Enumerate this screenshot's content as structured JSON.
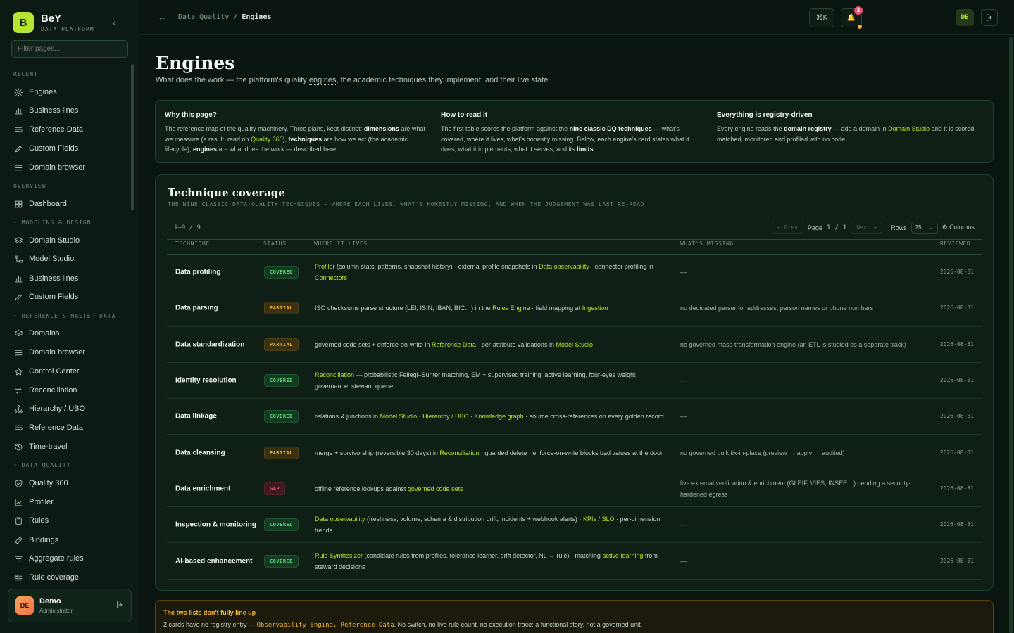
{
  "brand": {
    "logo": "B",
    "name": "BeY",
    "sub": "DATA PLATFORM"
  },
  "sidebar": {
    "filter_placeholder": "Filter pages...",
    "sections": {
      "recent": "RECENT",
      "overview": "OVERVIEW",
      "modeling": "◦ MODELING & DESIGN",
      "reference": "◦ REFERENCE & MASTER DATA",
      "quality": "◦ DATA QUALITY"
    },
    "items": [
      {
        "label": "Engines",
        "icon": "engine-icon"
      },
      {
        "label": "Business lines",
        "icon": "bar-chart-icon"
      },
      {
        "label": "Reference Data",
        "icon": "list-icon"
      },
      {
        "label": "Custom Fields",
        "icon": "pencil-icon"
      },
      {
        "label": "Domain browser",
        "icon": "menu-icon"
      },
      {
        "label": "Dashboard",
        "icon": "grid-icon"
      },
      {
        "label": "Domain Studio",
        "icon": "layers-icon"
      },
      {
        "label": "Model Studio",
        "icon": "model-icon"
      },
      {
        "label": "Business lines",
        "icon": "bar-chart-icon"
      },
      {
        "label": "Custom Fields",
        "icon": "pencil-icon"
      },
      {
        "label": "Domains",
        "icon": "layers-icon"
      },
      {
        "label": "Domain browser",
        "icon": "menu-icon"
      },
      {
        "label": "Control Center",
        "icon": "star-icon"
      },
      {
        "label": "Reconciliation",
        "icon": "swap-icon"
      },
      {
        "label": "Hierarchy / UBO",
        "icon": "hierarchy-icon"
      },
      {
        "label": "Reference Data",
        "icon": "list-icon"
      },
      {
        "label": "Time-travel",
        "icon": "history-icon"
      },
      {
        "label": "Quality 360",
        "icon": "shield-check-icon"
      },
      {
        "label": "Profiler",
        "icon": "line-chart-icon"
      },
      {
        "label": "Rules",
        "icon": "clipboard-icon"
      },
      {
        "label": "Bindings",
        "icon": "link-icon"
      },
      {
        "label": "Aggregate rules",
        "icon": "filter-icon"
      },
      {
        "label": "Rule coverage",
        "icon": "coverage-icon"
      }
    ]
  },
  "user": {
    "initials": "DE",
    "name": "Demo",
    "role": "Administrator"
  },
  "header": {
    "crumb_parent": "Data Quality",
    "crumb_sep": "/",
    "crumb_current": "Engines",
    "shortcut": "⌘K",
    "notif_count": "2",
    "avatar": "DE"
  },
  "page": {
    "title": "Engines",
    "subtitle_pre": "What does the work — the platform's quality ",
    "subtitle_u": "engines",
    "subtitle_post": ", the academic techniques they implement, and their live state"
  },
  "info": {
    "c1_h": "Why this page?",
    "c1_t1": "The reference map of the quality machinery. Three plans, kept distinct: ",
    "c1_b1": "dimensions",
    "c1_t2": " are what we measure (a result, read on ",
    "c1_l1": "Quality 360",
    "c1_t3": "), ",
    "c1_b2": "techniques",
    "c1_t4": " are how we act (the academic lifecycle), ",
    "c1_b3": "engines",
    "c1_t5": " are what does the work — described here.",
    "c2_h": "How to read it",
    "c2_t1": "The first table scores the platform against the ",
    "c2_b1": "nine classic DQ techniques",
    "c2_t2": " — what's covered, where it lives, what's honestly missing. Below, each engine's card states what it does, what it implements, what it serves, and its ",
    "c2_b2": "limits",
    "c2_t3": ".",
    "c3_h": "Everything is registry-driven",
    "c3_t1": "Every engine reads the ",
    "c3_b1": "domain registry",
    "c3_t2": " — add a domain in ",
    "c3_l1": "Domain Studio",
    "c3_t3": " and it is scored, matched, monitored and profiled with no code."
  },
  "coverage": {
    "title": "Technique coverage",
    "subtitle": "THE NINE CLASSIC DATA-QUALITY TECHNIQUES — WHERE EACH LIVES, WHAT'S HONESTLY MISSING, AND WHEN THE JUDGEMENT WAS LAST RE-READ",
    "count": "1–9 / 9",
    "prev": "← Prev",
    "page_label": "Page",
    "page_num": "1",
    "page_of": "/",
    "page_total": "1",
    "next": "Next →",
    "rows_label": "Rows",
    "rows_value": "25",
    "columns_btn": "⚙ Columns",
    "headers": {
      "technique": "TECHNIQUE",
      "status": "STATUS",
      "where": "WHERE IT LIVES",
      "missing": "WHAT'S MISSING",
      "reviewed": "REVIEWED"
    },
    "rows": [
      {
        "technique": "Data profiling",
        "status": "COVERED",
        "kind": "covered",
        "where": [
          [
            "l",
            "Profiler"
          ],
          [
            "t",
            " (column stats, patterns, snapshot history) · external profile snapshots in "
          ],
          [
            "l",
            "Data observability"
          ],
          [
            "t",
            " · connector profiling in "
          ],
          [
            "l",
            "Connectors"
          ]
        ],
        "missing": "—",
        "reviewed": "2026-08-31"
      },
      {
        "technique": "Data parsing",
        "status": "PARTIAL",
        "kind": "partial",
        "where": [
          [
            "t",
            "ISO checksums parse structure (LEI, ISIN, IBAN, BIC…) in the "
          ],
          [
            "l",
            "Rules Engine"
          ],
          [
            "t",
            " · field mapping at "
          ],
          [
            "l",
            "Ingestion"
          ]
        ],
        "missing": "no dedicated parser for addresses, person names or phone numbers",
        "reviewed": "2026-08-31"
      },
      {
        "technique": "Data standardization",
        "status": "PARTIAL",
        "kind": "partial",
        "where": [
          [
            "t",
            "governed code sets + enforce-on-write in "
          ],
          [
            "l",
            "Reference Data"
          ],
          [
            "t",
            " · per-attribute validations in "
          ],
          [
            "l",
            "Model Studio"
          ]
        ],
        "missing": "no governed mass-transformation engine (an ETL is studied as a separate track)",
        "reviewed": "2026-08-31"
      },
      {
        "technique": "Identity resolution",
        "status": "COVERED",
        "kind": "covered",
        "where": [
          [
            "l",
            "Reconciliation"
          ],
          [
            "t",
            " — probabilistic Fellegi–Sunter matching, EM + supervised training, active learning, four-eyes weight governance, steward queue"
          ]
        ],
        "missing": "—",
        "reviewed": "2026-08-31"
      },
      {
        "technique": "Data linkage",
        "status": "COVERED",
        "kind": "covered",
        "where": [
          [
            "t",
            "relations & junctions in "
          ],
          [
            "l",
            "Model Studio"
          ],
          [
            "t",
            " · "
          ],
          [
            "l",
            "Hierarchy / UBO"
          ],
          [
            "t",
            " · "
          ],
          [
            "l",
            "Knowledge graph"
          ],
          [
            "t",
            " · source cross-references on every golden record"
          ]
        ],
        "missing": "—",
        "reviewed": "2026-08-31"
      },
      {
        "technique": "Data cleansing",
        "status": "PARTIAL",
        "kind": "partial",
        "where": [
          [
            "t",
            "merge + survivorship (reversible 30 days) in "
          ],
          [
            "l",
            "Reconciliation"
          ],
          [
            "t",
            " · guarded delete · enforce-on-write blocks bad values at the door"
          ]
        ],
        "missing": "no governed bulk fix-in-place (preview → apply → audited)",
        "reviewed": "2026-08-31"
      },
      {
        "technique": "Data enrichment",
        "status": "GAP",
        "kind": "gap",
        "where": [
          [
            "t",
            "offline reference lookups against "
          ],
          [
            "l",
            "governed code sets"
          ]
        ],
        "missing": "live external verification & enrichment (GLEIF, VIES, INSEE…) pending a security-hardened egress",
        "reviewed": "2026-08-31"
      },
      {
        "technique": "Inspection & monitoring",
        "status": "COVERED",
        "kind": "covered",
        "where": [
          [
            "l",
            "Data observability"
          ],
          [
            "t",
            " (freshness, volume, schema & distribution drift, incidents + webhook alerts) · "
          ],
          [
            "l",
            "KPIs / SLO"
          ],
          [
            "t",
            " · per-dimension trends"
          ]
        ],
        "missing": "—",
        "reviewed": "2026-08-31"
      },
      {
        "technique": "AI-based enhancement",
        "status": "COVERED",
        "kind": "covered",
        "where": [
          [
            "l",
            "Rule Synthesizer"
          ],
          [
            "t",
            " (candidate rules from profiles, tolerance learner, drift detector, NL → rule) · matching "
          ],
          [
            "l",
            "active learning"
          ],
          [
            "t",
            " from steward decisions"
          ]
        ],
        "missing": "—",
        "reviewed": "2026-08-31"
      }
    ]
  },
  "warning": {
    "title": "The two lists don't fully line up",
    "text1": "2 cards have no registry entry — ",
    "code": "Observability Engine, Reference Data",
    "text2": ". No switch, no live rule count, no execution trace: a functional story, not a governed unit."
  }
}
